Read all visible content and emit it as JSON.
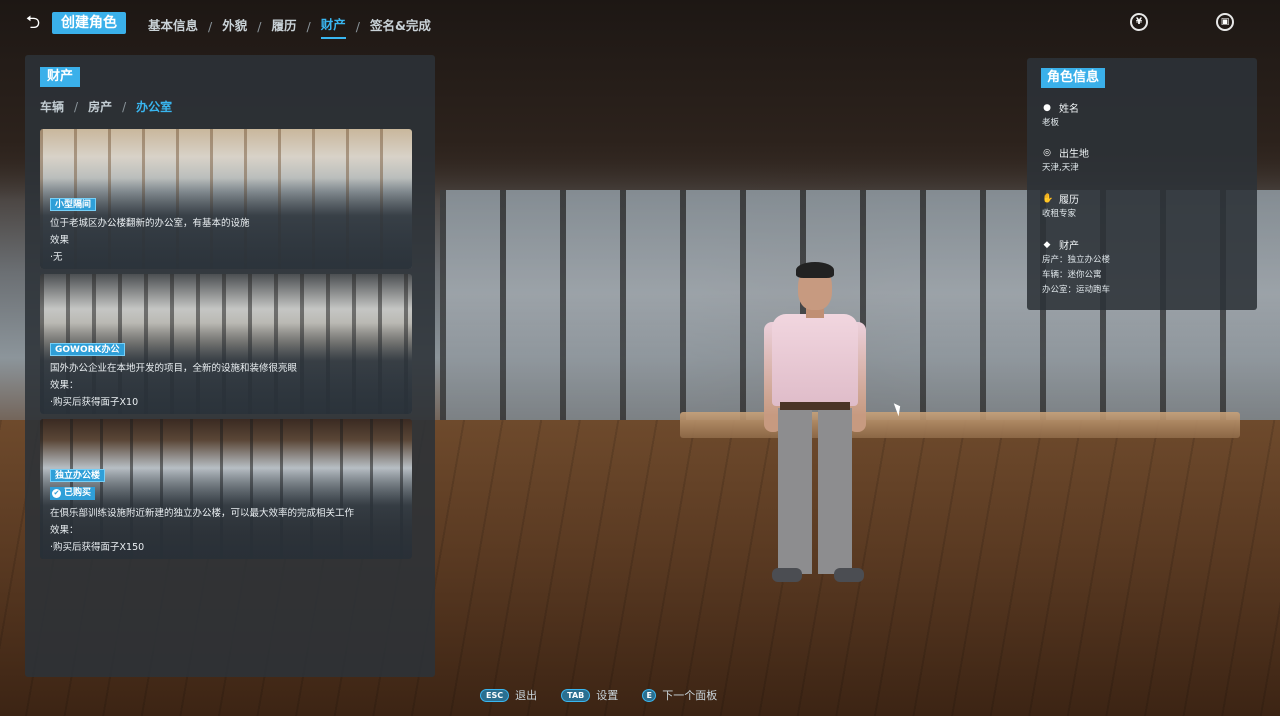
{
  "topbar": {
    "current_step": "创建角色",
    "steps": [
      {
        "label": "基本信息",
        "active": false
      },
      {
        "label": "外貌",
        "active": false
      },
      {
        "label": "履历",
        "active": false
      },
      {
        "label": "财产",
        "active": true
      },
      {
        "label": "签名&完成",
        "active": false
      }
    ],
    "separator": "/",
    "icons": [
      "yuan-coin-icon",
      "token-icon"
    ],
    "yuan_glyph": "¥",
    "token_glyph": "▣"
  },
  "left_panel": {
    "title": "财产",
    "subtabs": [
      {
        "label": "车辆",
        "active": false
      },
      {
        "label": "房产",
        "active": false
      },
      {
        "label": "办公室",
        "active": true
      }
    ],
    "cards": [
      {
        "name": "小型隔间",
        "owned": false,
        "description": "位于老城区办公楼翻新的办公室，有基本的设施",
        "effect_label": "效果",
        "effect": "·无"
      },
      {
        "name": "GOWORK办公",
        "owned": false,
        "description": "国外办公企业在本地开发的项目，全新的设施和装修很亮眼",
        "effect_label": "效果：",
        "effect": "·购买后获得面子X10"
      },
      {
        "name": "独立办公楼",
        "owned": true,
        "owned_label": "已购买",
        "description": "在俱乐部训练设施附近新建的独立办公楼，可以最大效率的完成相关工作",
        "effect_label": "效果：",
        "effect": "·购买后获得面子X150"
      }
    ]
  },
  "right_panel": {
    "title": "角色信息",
    "fields": [
      {
        "label": "姓名",
        "icon": "person-icon",
        "values": [
          "老板"
        ]
      },
      {
        "label": "出生地",
        "icon": "location-pin-icon",
        "values": [
          "天津,天津"
        ]
      },
      {
        "label": "履历",
        "icon": "handshake-icon",
        "values": [
          "收租专家"
        ]
      },
      {
        "label": "财产",
        "icon": "user-coin-icon",
        "values": [
          "房产：独立办公楼",
          "车辆：迷你公寓",
          "办公室：运动跑车"
        ]
      }
    ]
  },
  "hints": [
    {
      "key": "ESC",
      "label": "退出"
    },
    {
      "key": "TAB",
      "label": "设置"
    },
    {
      "key": "E",
      "label": "下一个面板"
    }
  ],
  "colors": {
    "accent": "#3ab0ea",
    "panel_bg": "#2c3238",
    "text": "#e6eef2"
  }
}
